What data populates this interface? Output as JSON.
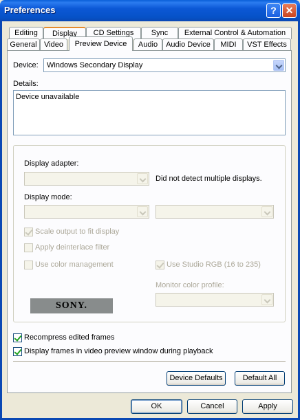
{
  "window": {
    "title": "Preferences",
    "help_glyph": "?",
    "close_glyph": "✕"
  },
  "tabs": {
    "row_top": [
      "Editing",
      "Display",
      "CD Settings",
      "Sync",
      "External Control & Automation"
    ],
    "row_bottom": [
      "General",
      "Video",
      "Preview Device",
      "Audio",
      "Audio Device",
      "MIDI",
      "VST Effects"
    ],
    "active": "Preview Device"
  },
  "device": {
    "label": "Device:",
    "value": "Windows Secondary Display"
  },
  "details": {
    "label": "Details:",
    "value": "Device unavailable"
  },
  "display_adapter": {
    "label": "Display adapter:",
    "value": "",
    "note": "Did not detect multiple displays."
  },
  "display_mode": {
    "label": "Display mode:",
    "value_1": "",
    "value_2": ""
  },
  "options": {
    "scale_output": {
      "label": "Scale output to fit display",
      "checked": true,
      "enabled": false
    },
    "deinterlace": {
      "label": "Apply deinterlace filter",
      "checked": false,
      "enabled": false
    },
    "color_management": {
      "label": "Use color management",
      "checked": false,
      "enabled": false
    },
    "studio_rgb": {
      "label": "Use Studio RGB (16 to 235)",
      "checked": true,
      "enabled": false
    }
  },
  "monitor_profile": {
    "label": "Monitor color profile:",
    "value": ""
  },
  "logo": {
    "text": "SONY."
  },
  "recompress": {
    "label": "Recompress edited frames",
    "checked": true
  },
  "display_frames": {
    "label": "Display frames in video preview window during playback",
    "checked": true
  },
  "buttons": {
    "device_defaults": "Device Defaults",
    "default_all": "Default All",
    "ok": "OK",
    "cancel": "Cancel",
    "apply": "Apply"
  }
}
